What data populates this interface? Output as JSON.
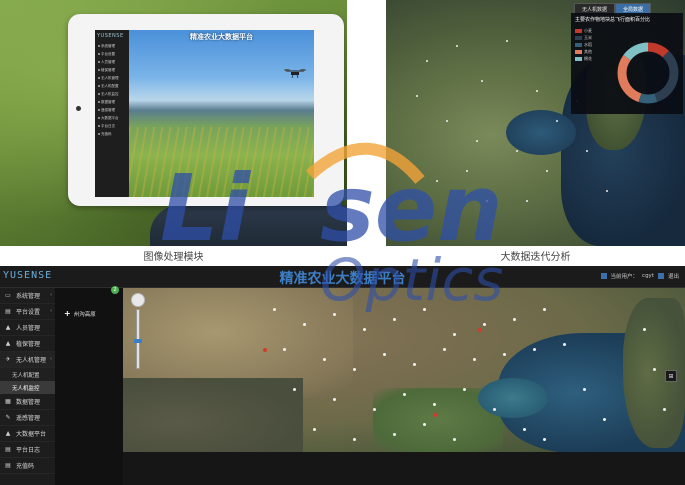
{
  "captions": {
    "image_module": "图像处理模块",
    "bigdata_analysis": "大数据迭代分析"
  },
  "tablet": {
    "brand": "YUSENSE",
    "title": "精准农业大数据平台",
    "nav": [
      "系统管理",
      "平台设置",
      "人员管理",
      "植保管理",
      "无人机管理",
      "无人机配置",
      "无人机监控",
      "数据管理",
      "遥感管理",
      "大数据平台",
      "平台日志",
      "充值码"
    ]
  },
  "stats_panel": {
    "tabs": [
      "无人机数据",
      "全局数据"
    ],
    "active_tab": 1,
    "title": "主要农作物地块总飞行面积百分比",
    "legend": [
      {
        "label": "小麦",
        "color": "#c0392b"
      },
      {
        "label": "玉米",
        "color": "#2c3e50"
      },
      {
        "label": "水稻",
        "color": "#34607a"
      },
      {
        "label": "其他",
        "color": "#e07b5b"
      },
      {
        "label": "棉花",
        "color": "#7fc1c5"
      }
    ],
    "donut_fraction": [
      0.12,
      0.33,
      0.1,
      0.3,
      0.15
    ]
  },
  "dashboard": {
    "brand": "YUSENSE",
    "title": "精准农业大数据平台",
    "user_label": "当前用户：",
    "user_name": "cgyt",
    "logout": "退出",
    "sidebar": [
      {
        "label": "系统管理",
        "icon": "▭",
        "expanded": false,
        "has_chevron": true
      },
      {
        "label": "平台设置",
        "icon": "▤",
        "expanded": false,
        "has_chevron": true
      },
      {
        "label": "人员管理",
        "icon": "▲",
        "expanded": false,
        "has_chevron": false
      },
      {
        "label": "植保管理",
        "icon": "▲",
        "expanded": false,
        "has_chevron": false
      },
      {
        "label": "无人机管理",
        "icon": "✈",
        "expanded": true,
        "has_chevron": true
      }
    ],
    "submenu": [
      {
        "label": "无人机配置",
        "active": false
      },
      {
        "label": "无人机监控",
        "active": true
      }
    ],
    "sidebar_more": [
      {
        "label": "数据管理",
        "icon": "▦"
      },
      {
        "label": "遥感管理",
        "icon": "✎"
      },
      {
        "label": "大数据平台",
        "icon": "▲"
      },
      {
        "label": "平台日志",
        "icon": "▤"
      },
      {
        "label": "充值码",
        "icon": "▤"
      }
    ],
    "panel2_item": "州沟高原",
    "panel2_badge": "2",
    "layer_icon": "⊞"
  },
  "watermark": {
    "brand_a": "Li",
    "brand_b": "sen",
    "tagline": "Optics"
  }
}
